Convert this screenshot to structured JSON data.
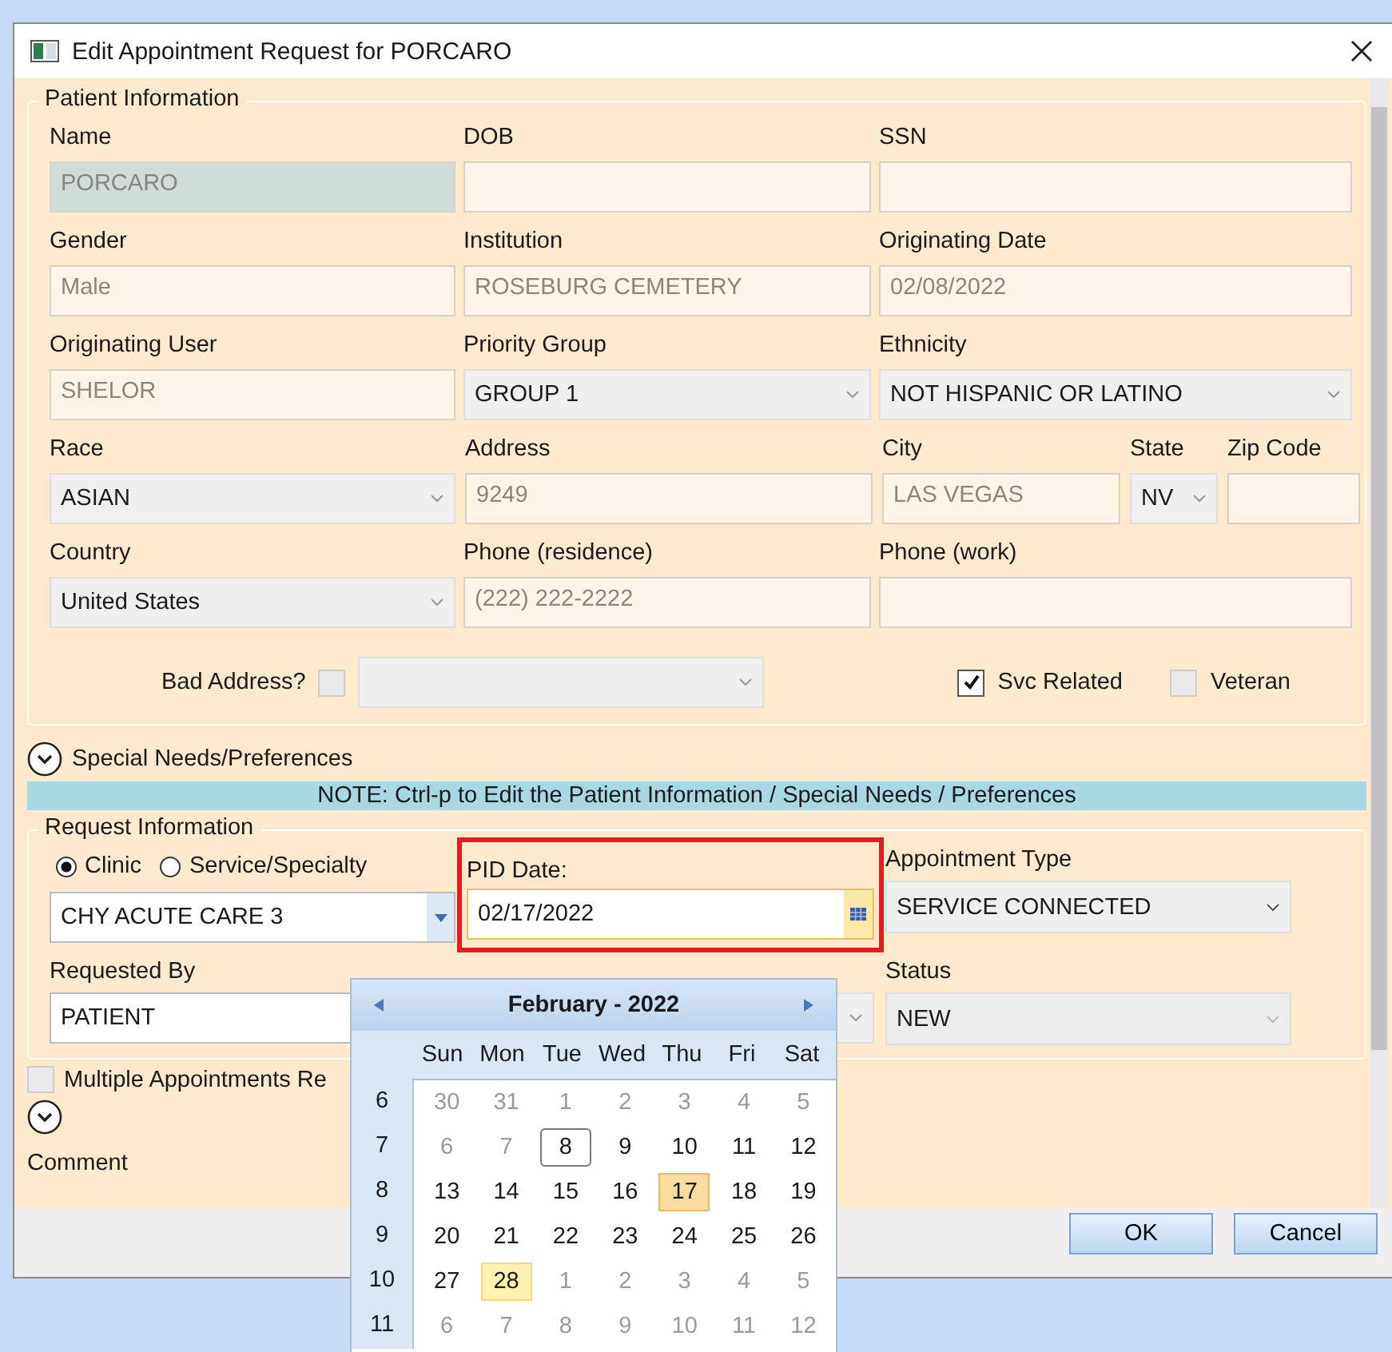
{
  "window": {
    "title": "Edit Appointment Request for  PORCARO"
  },
  "patient_information": {
    "title": "Patient Information",
    "rows": [
      [
        {
          "label": "Name",
          "value": "PORCARO",
          "kind": "locked"
        },
        {
          "label": "DOB",
          "kind": "text"
        },
        {
          "label": "SSN",
          "kind": "text"
        }
      ],
      [
        {
          "label": "Gender",
          "value": "Male",
          "kind": "text"
        },
        {
          "label": "Institution",
          "value": "ROSEBURG CEMETERY",
          "kind": "text"
        },
        {
          "label": "Originating Date",
          "value": "02/08/2022",
          "kind": "text"
        }
      ],
      [
        {
          "label": "Originating User",
          "value": "SHELOR",
          "kind": "text"
        },
        {
          "label": "Priority Group",
          "value": "GROUP 1",
          "kind": "combo"
        },
        {
          "label": "Ethnicity",
          "value": "NOT HISPANIC OR LATINO",
          "kind": "combo"
        }
      ],
      [
        {
          "label": "Race",
          "value": "ASIAN",
          "kind": "combo"
        },
        {
          "label": "Address",
          "value": "9249",
          "kind": "text"
        },
        {
          "label": "City",
          "value": "LAS VEGAS",
          "kind": "text"
        },
        {
          "label": "State",
          "value": "NV",
          "kind": "combo"
        },
        {
          "label": "Zip Code",
          "kind": "text"
        }
      ],
      [
        {
          "label": "Country",
          "value": "United States",
          "kind": "combo"
        },
        {
          "label": "Phone (residence)",
          "value": "(222) 222-2222",
          "kind": "text"
        },
        {
          "label": "Phone (work)",
          "kind": "text"
        }
      ]
    ],
    "bad_address": {
      "label": "Bad Address?",
      "checked": false
    },
    "svc_related": {
      "label": "Svc Related",
      "checked": true
    },
    "veteran": {
      "label": "Veteran",
      "checked": false
    }
  },
  "special_needs": {
    "label": "Special Needs/Preferences",
    "expanded": false
  },
  "note": "NOTE:  Ctrl-p to Edit the Patient Information / Special Needs / Preferences",
  "request_information": {
    "title": "Request Information",
    "radios": [
      {
        "label": "Clinic",
        "selected": true
      },
      {
        "label": "Service/Specialty",
        "selected": false
      }
    ],
    "clinic": {
      "value": "CHY ACUTE CARE 3"
    },
    "pid_date": {
      "label": "PID Date:",
      "value": "02/17/2022"
    },
    "appointment_type": {
      "label": "Appointment Type",
      "value": "SERVICE CONNECTED"
    },
    "requested_by": {
      "label": "Requested By",
      "value": "PATIENT"
    },
    "status": {
      "label": "Status",
      "value": "NEW"
    }
  },
  "multiple_appointments": {
    "label": "Multiple Appointments Re",
    "checked": false
  },
  "comment": {
    "label": "Comment",
    "expanded": false
  },
  "buttons": [
    "OK",
    "Cancel"
  ],
  "calendar": {
    "title": "February - 2022",
    "weekdays": [
      "Sun",
      "Mon",
      "Tue",
      "Wed",
      "Thu",
      "Fri",
      "Sat"
    ],
    "weeks": [
      {
        "number": "6",
        "days": [
          {
            "d": "30",
            "kind": "other",
            "selected": false
          },
          {
            "d": "31",
            "kind": "other",
            "selected": false
          },
          {
            "d": "1",
            "kind": "other",
            "selected": false
          },
          {
            "d": "2",
            "kind": "other",
            "selected": false
          },
          {
            "d": "3",
            "kind": "other",
            "selected": false
          },
          {
            "d": "4",
            "kind": "other",
            "selected": false
          },
          {
            "d": "5",
            "kind": "other",
            "selected": false
          }
        ]
      },
      {
        "number": "7",
        "days": [
          {
            "d": "6",
            "kind": "other",
            "selected": false
          },
          {
            "d": "7",
            "kind": "other",
            "selected": false
          },
          {
            "d": "8",
            "kind": "today",
            "selected": false
          },
          {
            "d": "9",
            "kind": "day",
            "selected": false
          },
          {
            "d": "10",
            "kind": "day",
            "selected": false
          },
          {
            "d": "11",
            "kind": "day",
            "selected": false
          },
          {
            "d": "12",
            "kind": "day",
            "selected": false
          }
        ]
      },
      {
        "number": "8",
        "days": [
          {
            "d": "13",
            "kind": "day",
            "selected": false
          },
          {
            "d": "14",
            "kind": "day",
            "selected": false
          },
          {
            "d": "15",
            "kind": "day",
            "selected": false
          },
          {
            "d": "16",
            "kind": "day",
            "selected": false
          },
          {
            "d": "17",
            "kind": "day",
            "selected": true
          },
          {
            "d": "18",
            "kind": "day",
            "selected": false
          },
          {
            "d": "19",
            "kind": "day",
            "selected": false
          }
        ]
      },
      {
        "number": "9",
        "days": [
          {
            "d": "20",
            "kind": "day",
            "selected": false
          },
          {
            "d": "21",
            "kind": "day",
            "selected": false
          },
          {
            "d": "22",
            "kind": "day",
            "selected": false
          },
          {
            "d": "23",
            "kind": "day",
            "selected": false
          },
          {
            "d": "24",
            "kind": "day",
            "selected": false
          },
          {
            "d": "25",
            "kind": "day",
            "selected": false
          },
          {
            "d": "26",
            "kind": "day",
            "selected": false
          }
        ]
      },
      {
        "number": "10",
        "days": [
          {
            "d": "27",
            "kind": "day",
            "selected": false
          },
          {
            "d": "28",
            "kind": "marked",
            "selected": false
          },
          {
            "d": "1",
            "kind": "other",
            "selected": false
          },
          {
            "d": "2",
            "kind": "other",
            "selected": false
          },
          {
            "d": "3",
            "kind": "other",
            "selected": false
          },
          {
            "d": "4",
            "kind": "other",
            "selected": false
          },
          {
            "d": "5",
            "kind": "other",
            "selected": false
          }
        ]
      },
      {
        "number": "11",
        "days": [
          {
            "d": "6",
            "kind": "other",
            "selected": false
          },
          {
            "d": "7",
            "kind": "other",
            "selected": false
          },
          {
            "d": "8",
            "kind": "other",
            "selected": false
          },
          {
            "d": "9",
            "kind": "other",
            "selected": false
          },
          {
            "d": "10",
            "kind": "other",
            "selected": false
          },
          {
            "d": "11",
            "kind": "other",
            "selected": false
          },
          {
            "d": "12",
            "kind": "other",
            "selected": false
          }
        ]
      }
    ]
  }
}
